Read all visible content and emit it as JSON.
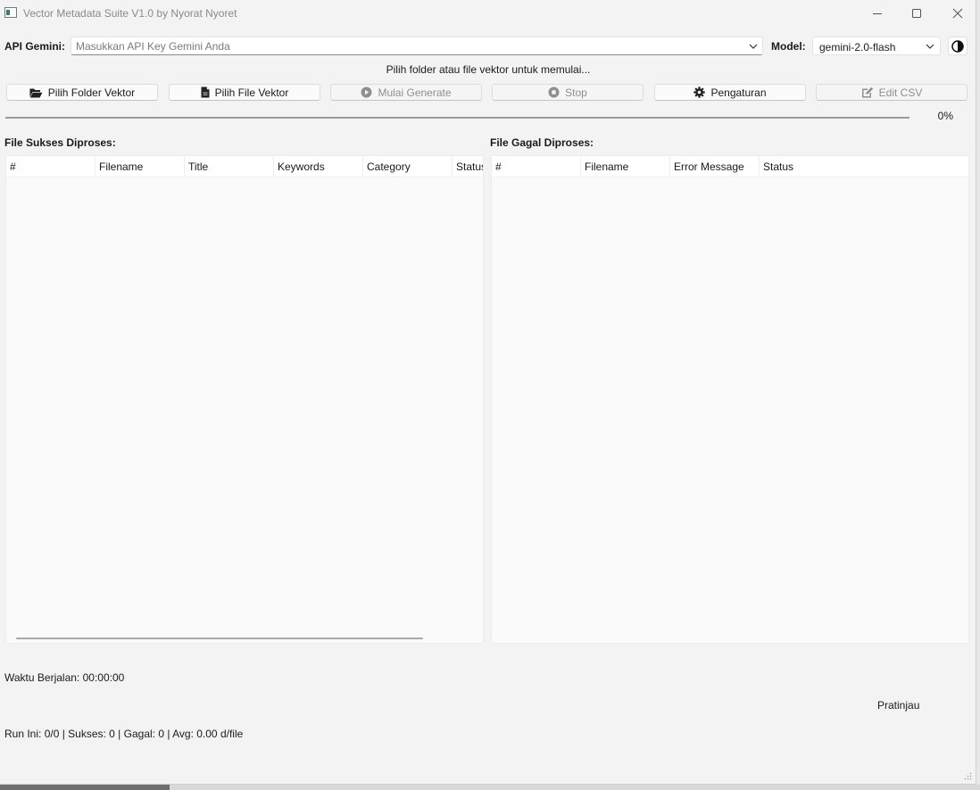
{
  "window": {
    "title": "Vector Metadata Suite V1.0 by Nyorat Nyoret"
  },
  "api": {
    "label": "API Gemini:",
    "placeholder": "Masukkan API Key Gemini Anda",
    "value": ""
  },
  "model": {
    "label": "Model:",
    "selected": "gemini-2.0-flash"
  },
  "status_message": "Pilih folder atau file vektor untuk memulai...",
  "toolbar": {
    "pick_folder": "Pilih Folder Vektor",
    "pick_file": "Pilih File Vektor",
    "start": "Mulai Generate",
    "stop": "Stop",
    "settings": "Pengaturan",
    "edit_csv": "Edit CSV"
  },
  "progress": {
    "value": 0,
    "label": "0%"
  },
  "success_table": {
    "title": "File Sukses Diproses:",
    "columns": [
      "#",
      "Filename",
      "Title",
      "Keywords",
      "Category",
      "Status"
    ],
    "rows": []
  },
  "failed_table": {
    "title": "File Gagal Diproses:",
    "columns": [
      "#",
      "Filename",
      "Error Message",
      "Status"
    ],
    "rows": []
  },
  "footer": {
    "elapsed": "Waktu Berjalan: 00:00:00",
    "preview": "Pratinjau",
    "run_stats": "Run Ini: 0/0 | Sukses: 0 | Gagal: 0 | Avg: 0.00 d/file"
  },
  "colors": {
    "window_bg": "#f3f3f3",
    "disabled_text": "#8f8f8f",
    "progress_accent": "#2a7bd4"
  }
}
